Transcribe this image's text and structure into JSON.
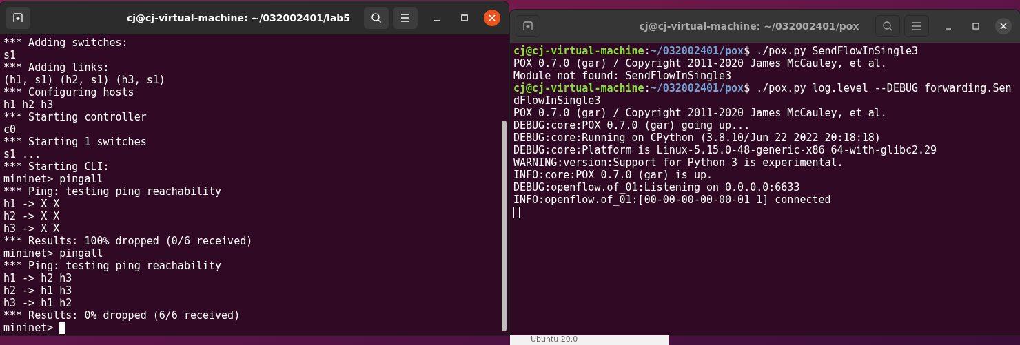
{
  "windows": [
    {
      "title": "cj@cj-virtual-machine: ~/032002401/lab5",
      "active": true,
      "lines": [
        {
          "kind": "output",
          "text": "*** Adding switches:"
        },
        {
          "kind": "output",
          "text": "s1"
        },
        {
          "kind": "output",
          "text": "*** Adding links:"
        },
        {
          "kind": "output",
          "text": "(h1, s1) (h2, s1) (h3, s1)"
        },
        {
          "kind": "output",
          "text": "*** Configuring hosts"
        },
        {
          "kind": "output",
          "text": "h1 h2 h3"
        },
        {
          "kind": "output",
          "text": "*** Starting controller"
        },
        {
          "kind": "output",
          "text": "c0"
        },
        {
          "kind": "output",
          "text": "*** Starting 1 switches"
        },
        {
          "kind": "output",
          "text": "s1 ..."
        },
        {
          "kind": "output",
          "text": "*** Starting CLI:"
        },
        {
          "kind": "output",
          "text": "mininet> pingall"
        },
        {
          "kind": "output",
          "text": "*** Ping: testing ping reachability"
        },
        {
          "kind": "output",
          "text": "h1 -> X X"
        },
        {
          "kind": "output",
          "text": "h2 -> X X"
        },
        {
          "kind": "output",
          "text": "h3 -> X X"
        },
        {
          "kind": "output",
          "text": "*** Results: 100% dropped (0/6 received)"
        },
        {
          "kind": "output",
          "text": "mininet> pingall"
        },
        {
          "kind": "output",
          "text": "*** Ping: testing ping reachability"
        },
        {
          "kind": "output",
          "text": "h1 -> h2 h3"
        },
        {
          "kind": "output",
          "text": "h2 -> h1 h3"
        },
        {
          "kind": "output",
          "text": "h3 -> h1 h2"
        },
        {
          "kind": "output",
          "text": "*** Results: 0% dropped (6/6 received)"
        },
        {
          "kind": "input",
          "text": "mininet>"
        }
      ]
    },
    {
      "title": "cj@cj-virtual-machine: ~/032002401/pox",
      "active": false,
      "lines": [
        {
          "kind": "prompt",
          "user": "cj@cj-virtual-machine",
          "separator": ":",
          "path": "~/032002401/pox",
          "prompt_mark": "$",
          "command": "./pox.py SendFlowInSingle3"
        },
        {
          "kind": "output",
          "text": "POX 0.7.0 (gar) / Copyright 2011-2020 James McCauley, et al."
        },
        {
          "kind": "output",
          "text": "Module not found: SendFlowInSingle3"
        },
        {
          "kind": "prompt",
          "user": "cj@cj-virtual-machine",
          "separator": ":",
          "path": "~/032002401/pox",
          "prompt_mark": "$",
          "command": "./pox.py log.level --DEBUG forwarding.Sen"
        },
        {
          "kind": "output",
          "text": "dFlowInSingle3"
        },
        {
          "kind": "output",
          "text": "POX 0.7.0 (gar) / Copyright 2011-2020 James McCauley, et al."
        },
        {
          "kind": "output",
          "text": "DEBUG:core:POX 0.7.0 (gar) going up..."
        },
        {
          "kind": "output",
          "text": "DEBUG:core:Running on CPython (3.8.10/Jun 22 2022 20:18:18)"
        },
        {
          "kind": "output",
          "text": "DEBUG:core:Platform is Linux-5.15.0-48-generic-x86_64-with-glibc2.29"
        },
        {
          "kind": "output",
          "text": "WARNING:version:Support for Python 3 is experimental."
        },
        {
          "kind": "output",
          "text": "INFO:core:POX 0.7.0 (gar) is up."
        },
        {
          "kind": "output",
          "text": "DEBUG:openflow.of_01:Listening on 0.0.0.0:6633"
        },
        {
          "kind": "output",
          "text": "INFO:openflow.of_01:[00-00-00-00-00-01 1] connected"
        },
        {
          "kind": "input"
        }
      ]
    }
  ],
  "background_window": {
    "label": "Ubuntu 20.0"
  }
}
